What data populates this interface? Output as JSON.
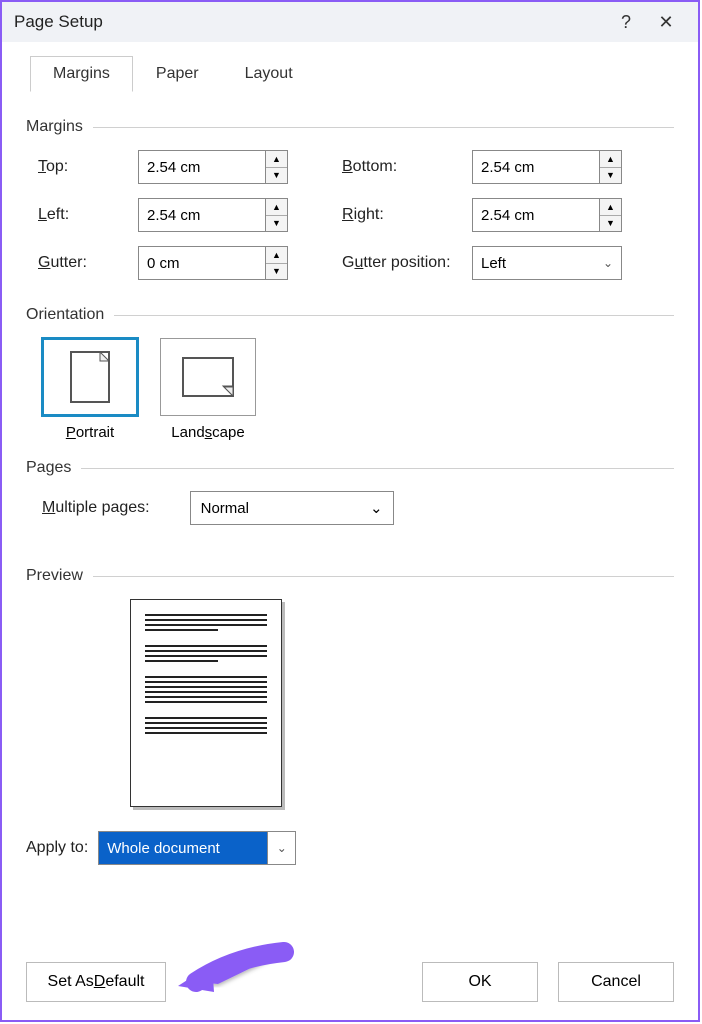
{
  "title": "Page Setup",
  "help": "?",
  "close": "✕",
  "tabs": {
    "margins": "Margins",
    "paper": "Paper",
    "layout": "Layout"
  },
  "groups": {
    "margins": "Margins",
    "orientation": "Orientation",
    "pages": "Pages",
    "preview": "Preview"
  },
  "margins": {
    "top": {
      "label": "Top:",
      "ul": "T",
      "value": "2.54 cm"
    },
    "bottom": {
      "label": "Bottom:",
      "ul": "B",
      "value": "2.54 cm"
    },
    "left": {
      "label": "Left:",
      "ul": "L",
      "value": "2.54 cm"
    },
    "right": {
      "label": "Right:",
      "ul": "R",
      "value": "2.54 cm"
    },
    "gutter": {
      "label": "Gutter:",
      "ul": "G",
      "value": "0 cm"
    },
    "gutterpos": {
      "label": "Gutter position:",
      "ul": "u",
      "value": "Left"
    }
  },
  "orientation": {
    "portrait": "Portrait",
    "portrait_ul": "P",
    "landscape": "Landscape",
    "landscape_ul": "s"
  },
  "pages": {
    "multiple_label": "Multiple pages:",
    "ul": "M",
    "value": "Normal"
  },
  "apply": {
    "label": "Apply to:",
    "value": "Whole document"
  },
  "buttons": {
    "set_default": "Set As Default",
    "set_default_ul": "D",
    "ok": "OK",
    "cancel": "Cancel"
  }
}
